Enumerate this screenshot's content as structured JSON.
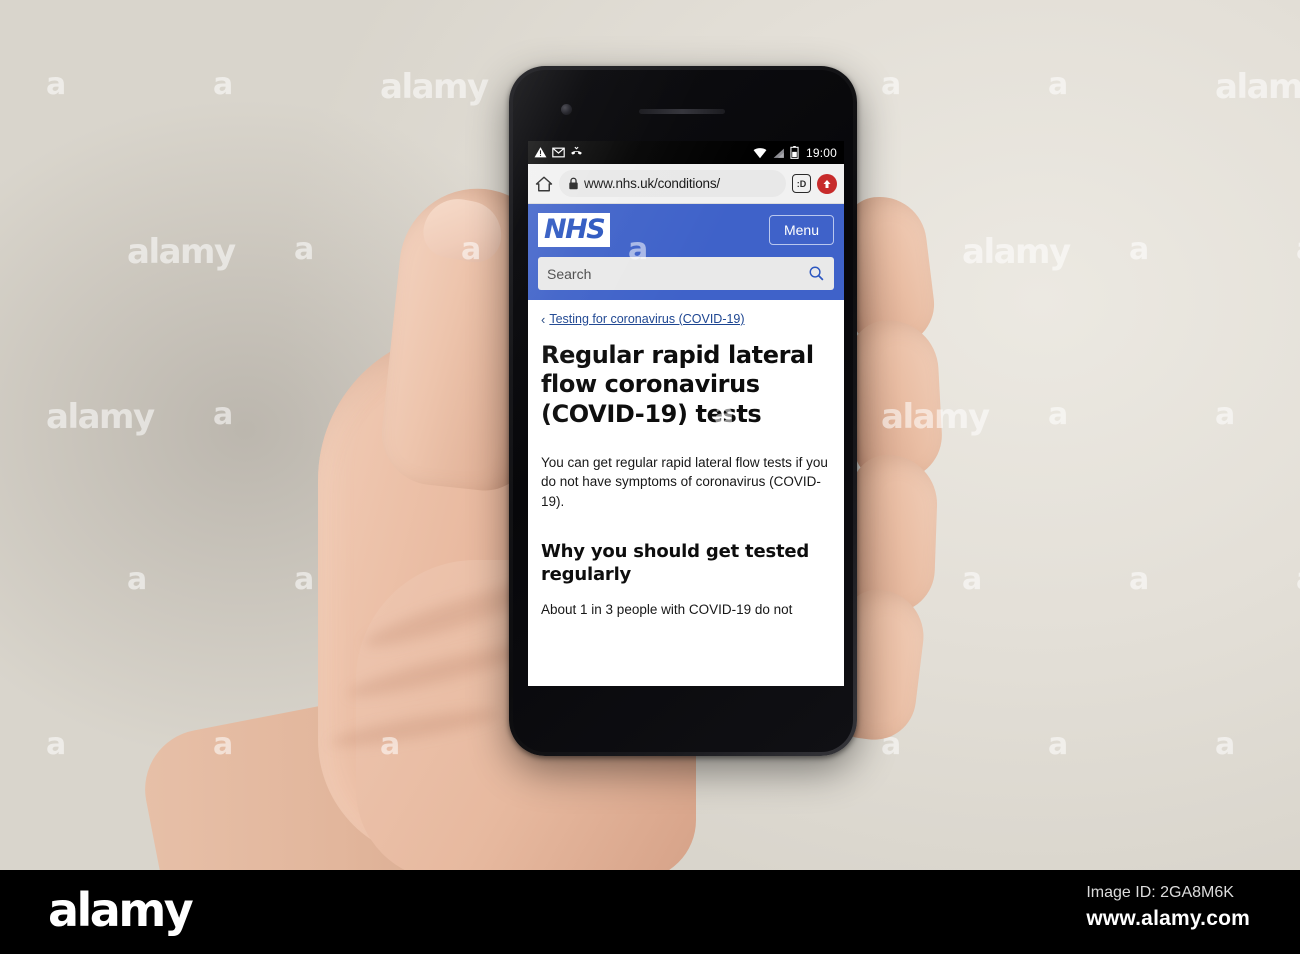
{
  "phone": {
    "status_bar": {
      "icons_left": [
        "warning-triangle-icon",
        "gmail-icon",
        "missed-call-icon"
      ],
      "icons_right": [
        "wifi-icon",
        "signal-icon",
        "battery-icon"
      ],
      "time": "19:00"
    },
    "browser": {
      "home_icon": "home-icon",
      "lock_icon": "lock-icon",
      "url": "www.nhs.uk/conditions/",
      "tab_count": ":D",
      "update_icon": "update-arrow-icon"
    }
  },
  "site": {
    "logo_text": "NHS",
    "menu_label": "Menu",
    "search": {
      "placeholder": "Search",
      "value": "",
      "icon": "search-icon"
    },
    "accent_blue": "#3f62c9",
    "logo_blue": "#2b56c0"
  },
  "article": {
    "breadcrumb": {
      "chevron": "‹",
      "label": "Testing for coronavirus (COVID-19)"
    },
    "title": "Regular rapid lateral flow coronavirus (COVID-19) tests",
    "intro": "You can get regular rapid lateral flow tests if you do not have symptoms of coronavirus (COVID-19).",
    "subheading": "Why you should get tested regularly",
    "paragraph": "About 1 in 3 people with COVID-19 do not"
  },
  "watermark": {
    "letter": "a",
    "word": "alamy"
  },
  "footer": {
    "logo": "alamy",
    "image_id": "Image ID: 2GA8M6K",
    "url": "www.alamy.com"
  }
}
